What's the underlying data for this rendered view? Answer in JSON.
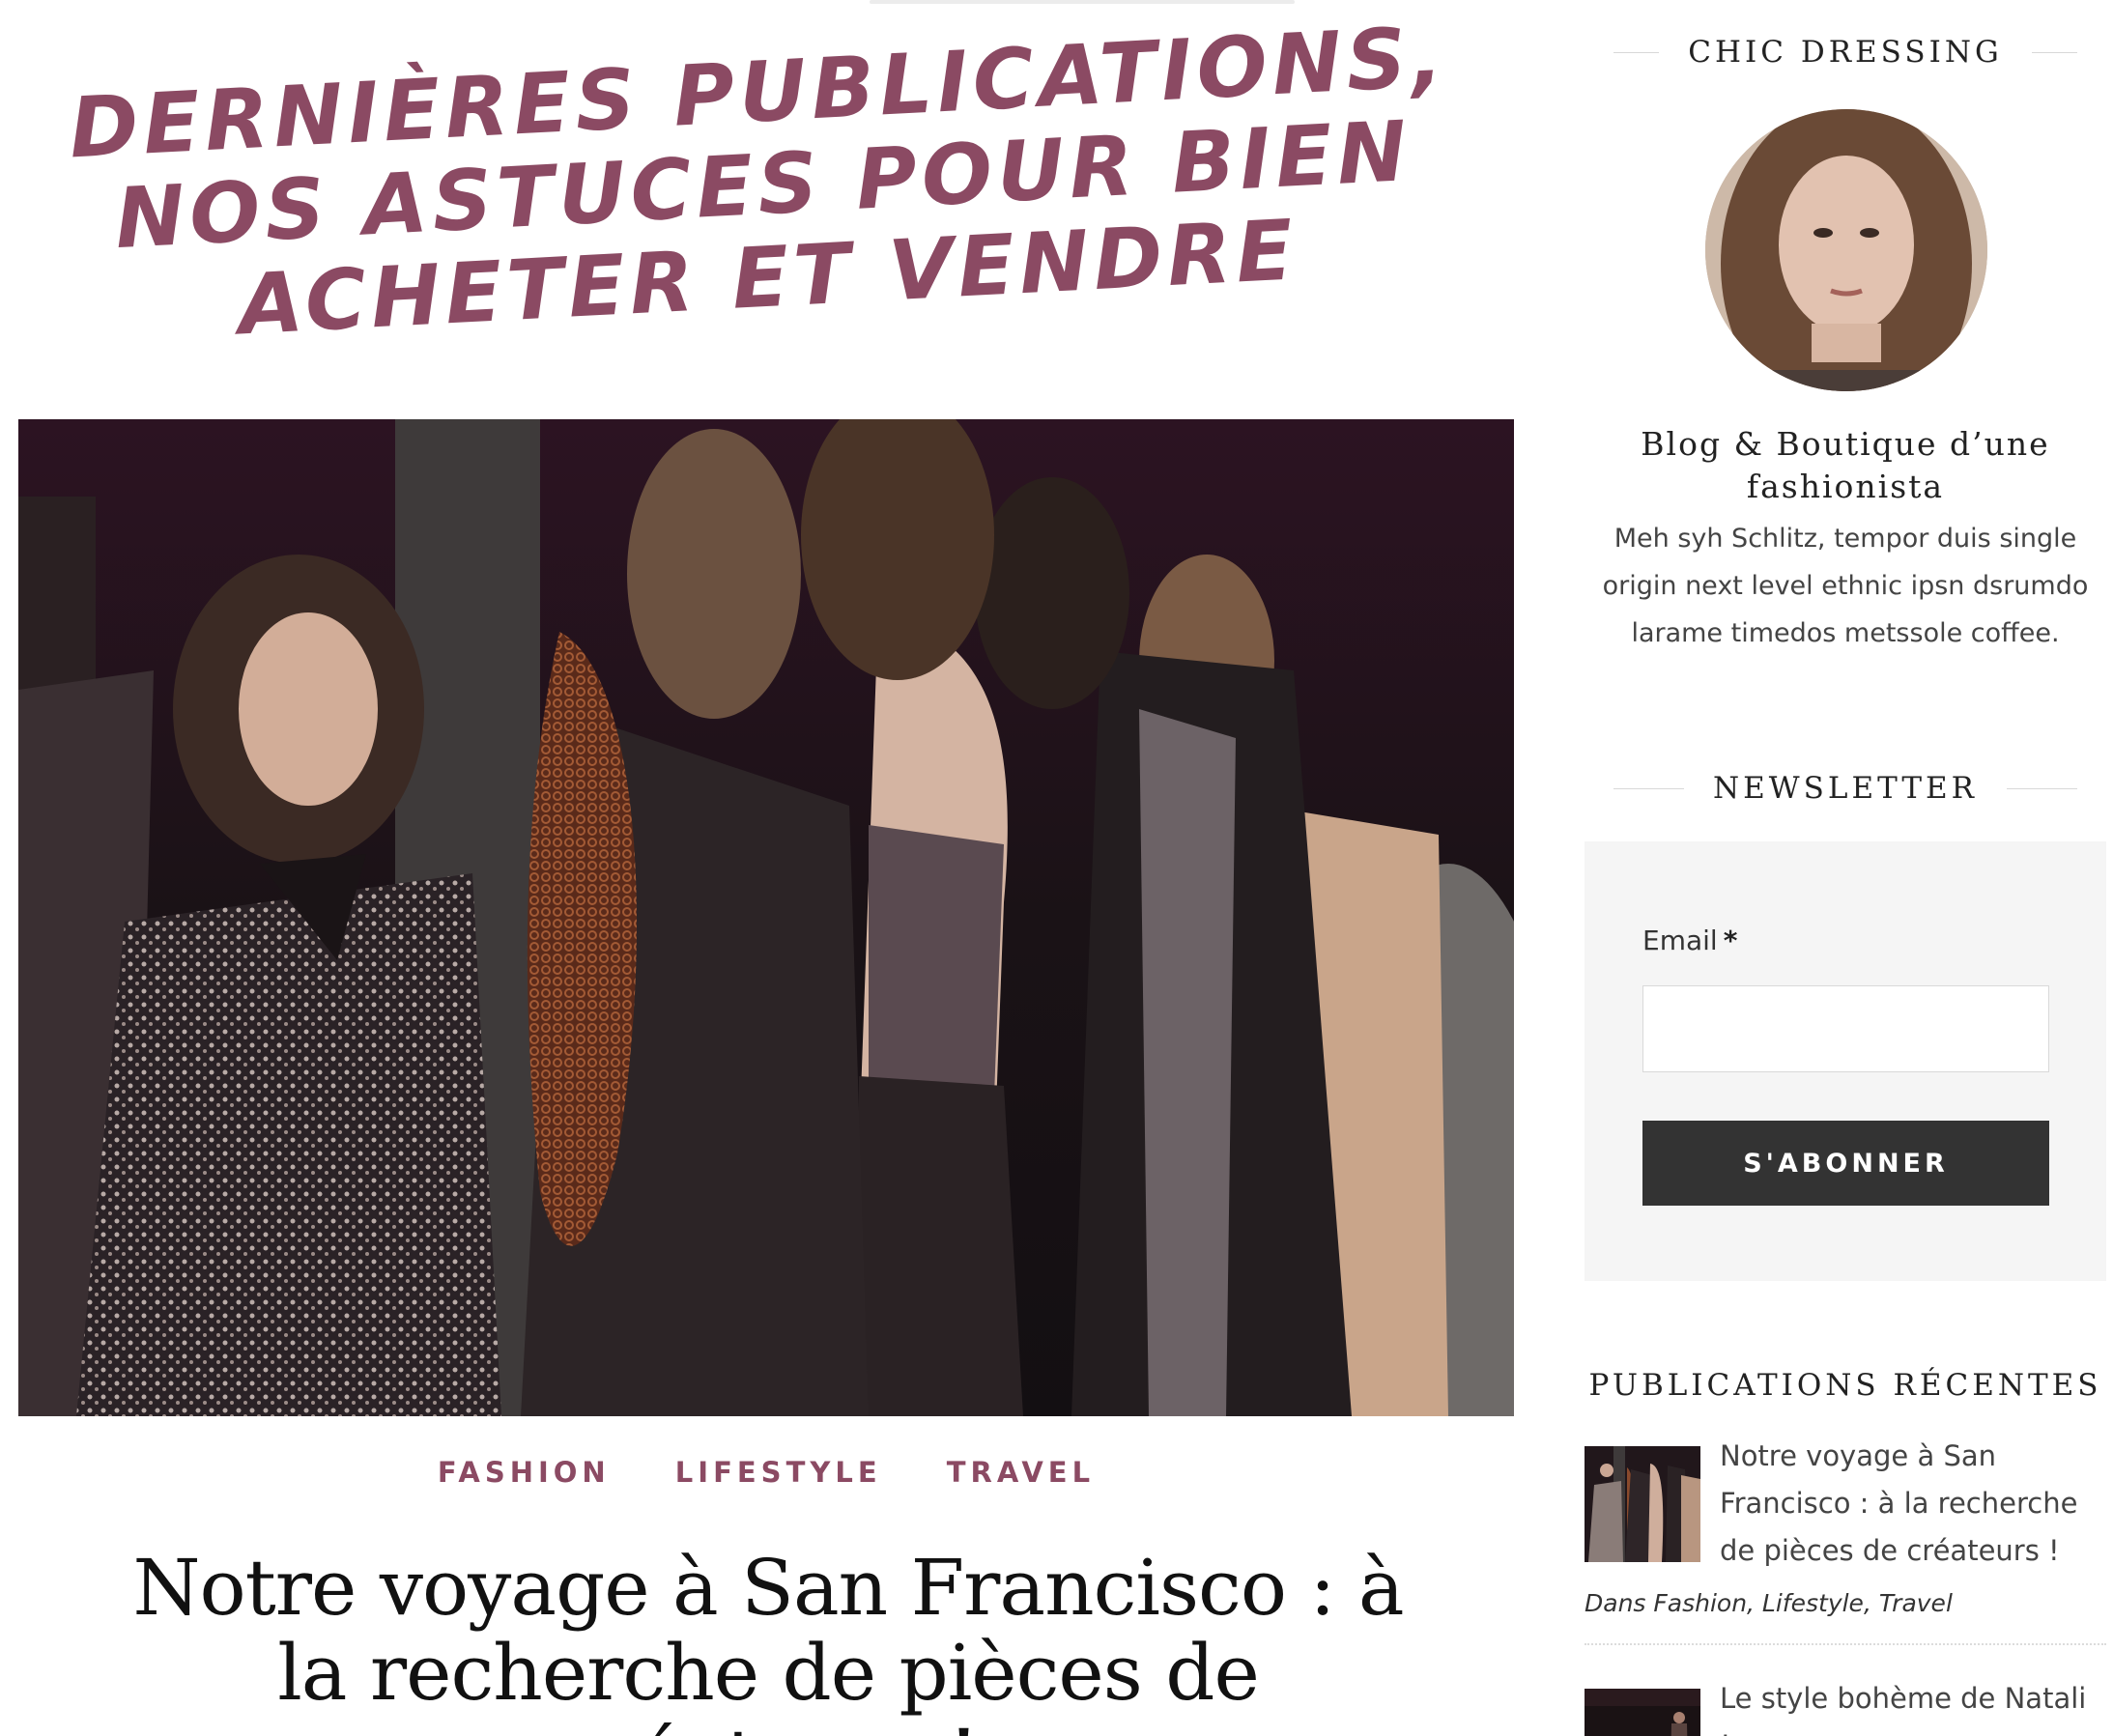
{
  "main": {
    "headline_lines": [
      "Dernières publications,",
      "nos astuces pour bien",
      "acheter et vendre"
    ],
    "categories": [
      "FASHION",
      "LIFESTYLE",
      "TRAVEL"
    ],
    "post_title": "Notre voyage à San Francisco : à la recherche de pièces de créateurs !"
  },
  "sidebar": {
    "about_title": "CHIC DRESSING",
    "blog_name": "Blog & Boutique d’une fashionista",
    "blog_description": "Meh syh Schlitz, tempor duis single origin next level ethnic ipsn dsrumdo larame timedos metssole coffee.",
    "newsletter_title": "NEWSLETTER",
    "email_label": "Email",
    "required_mark": "*",
    "email_value": "",
    "subscribe_label": "S'ABONNER",
    "recent_title": "PUBLICATIONS RÉCENTES",
    "recent_posts": [
      {
        "title": "Notre voyage à San Francisco : à la recherche de pièces de créateurs !",
        "categories": "Dans Fashion, Lifestyle, Travel"
      },
      {
        "title": "Le style bohème de Natali !",
        "categories": ""
      }
    ]
  },
  "colors": {
    "accent": "#8b4a63",
    "button": "#333333",
    "newsletter_bg": "#f5f5f5"
  }
}
